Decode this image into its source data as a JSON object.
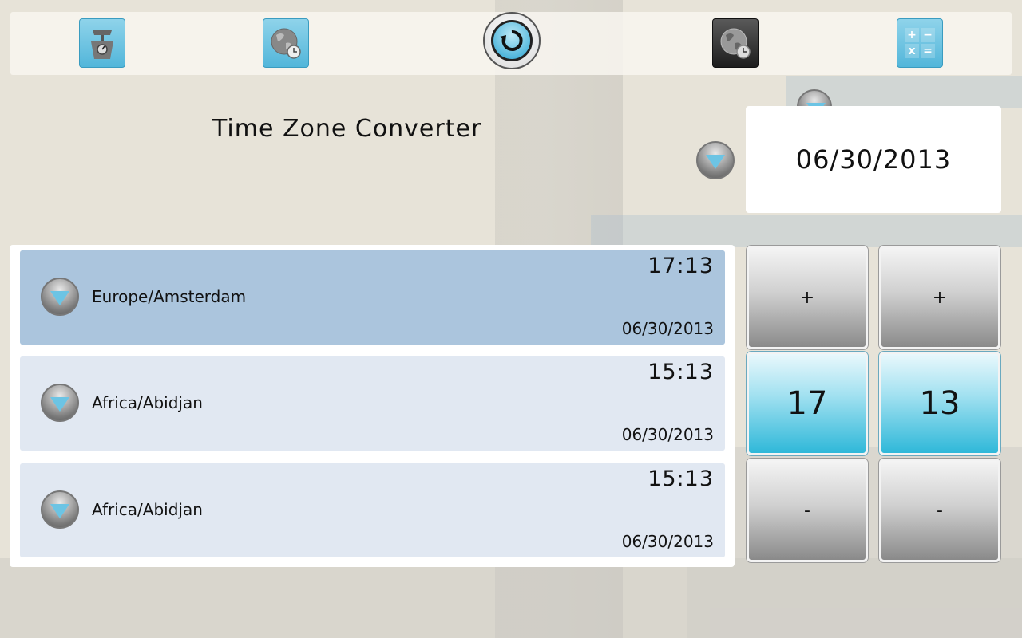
{
  "toolbar": {
    "buttons": [
      {
        "name": "scale-icon"
      },
      {
        "name": "world-clock-icon"
      },
      {
        "name": "refresh-icon"
      },
      {
        "name": "world-clock-dark-icon"
      },
      {
        "name": "calculator-icon"
      }
    ],
    "calculator_symbols": [
      "+",
      "−",
      "x",
      "="
    ]
  },
  "title": "Time Zone Converter",
  "date_picker": {
    "value": "06/30/2013"
  },
  "zones": [
    {
      "name": "Europe/Amsterdam",
      "time": "17:13",
      "date": "06/30/2013",
      "selected": true
    },
    {
      "name": "Africa/Abidjan",
      "time": "15:13",
      "date": "06/30/2013",
      "selected": false
    },
    {
      "name": "Africa/Abidjan",
      "time": "15:13",
      "date": "06/30/2013",
      "selected": false
    }
  ],
  "stepper": {
    "hour": {
      "plus": "+",
      "value": "17",
      "minus": "-"
    },
    "minute": {
      "plus": "+",
      "value": "13",
      "minus": "-"
    }
  },
  "colors": {
    "accent": "#52b6da",
    "row_selected": "#abc5dd",
    "row": "#e1e8f2"
  }
}
